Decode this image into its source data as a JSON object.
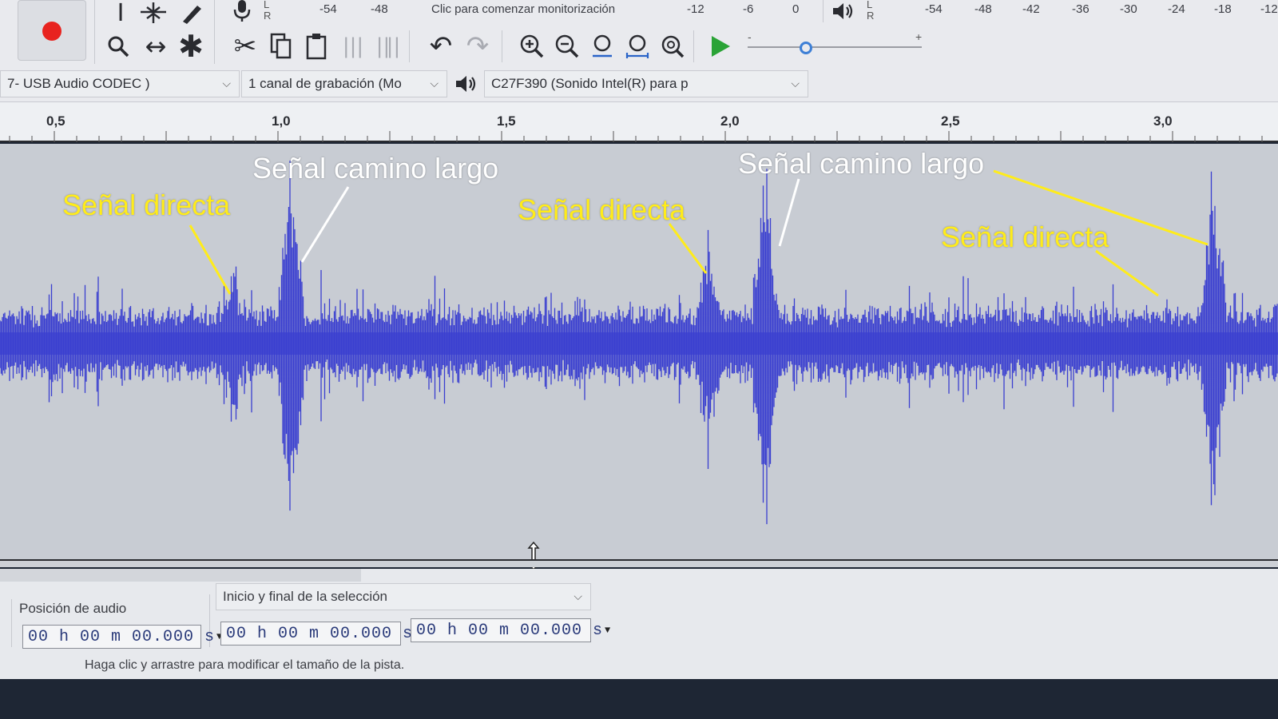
{
  "toolbar": {
    "record_button": "record",
    "tools": [
      "selection-tool-icon",
      "envelope-tool-icon",
      "draw-tool-icon",
      "zoom-tool-icon",
      "timeshift-tool-icon",
      "multi-tool-icon"
    ],
    "edit": [
      "cut-icon",
      "copy-icon",
      "paste-icon",
      "trim-icon",
      "silence-icon",
      "undo-icon",
      "redo-icon"
    ],
    "zoom": [
      "zoom-in-icon",
      "zoom-out-icon",
      "fit-selection-icon",
      "fit-project-icon",
      "zoom-toggle-icon"
    ],
    "play_at_speed": "play-icon",
    "record_meter": {
      "lr": [
        "L",
        "R"
      ],
      "scale": [
        "-54",
        "-48"
      ],
      "monitor_hint": "Clic para comenzar monitorización",
      "scale_right": [
        "-12",
        "-6",
        "0"
      ]
    },
    "playback_meter": {
      "lr": [
        "L",
        "R"
      ],
      "scale": [
        "-54",
        "-48",
        "-42",
        "-36",
        "-30",
        "-24",
        "-18",
        "-12"
      ]
    },
    "speed_slider": {
      "minus": "-",
      "plus": "+",
      "value_fraction": 0.3
    }
  },
  "devices": {
    "recording_device": "7- USB Audio CODEC )",
    "channels": "1 canal de grabación (Mo",
    "playback_device": "C27F390 (Sonido Intel(R) para p"
  },
  "ruler": {
    "labels": [
      "0,5",
      "1,0",
      "1,5",
      "2,0",
      "2,5",
      "3,0"
    ]
  },
  "annotations": {
    "direct_1": "Señal directa",
    "long_1": "Señal camino largo",
    "direct_2": "Señal directa",
    "long_2": "Señal camino largo",
    "direct_3": "Señal directa"
  },
  "colors": {
    "waveform": "#3a3fd0",
    "annotation_yellow": "#ffec1a",
    "annotation_white": "#ffffff",
    "record_red": "#e8231f",
    "play_green": "#2aa336"
  },
  "selection_bar": {
    "audio_position_label": "Posición de audio",
    "selection_mode": "Inicio y final de la selección",
    "audio_position": "00 h 00 m 00.000 s",
    "selection_start": "00 h 00 m 00.000 s",
    "selection_end": "00 h 00 m 00.000 s"
  },
  "status_bar": {
    "message": "Haga clic y arrastre para modificar el tamaño de la pista."
  }
}
